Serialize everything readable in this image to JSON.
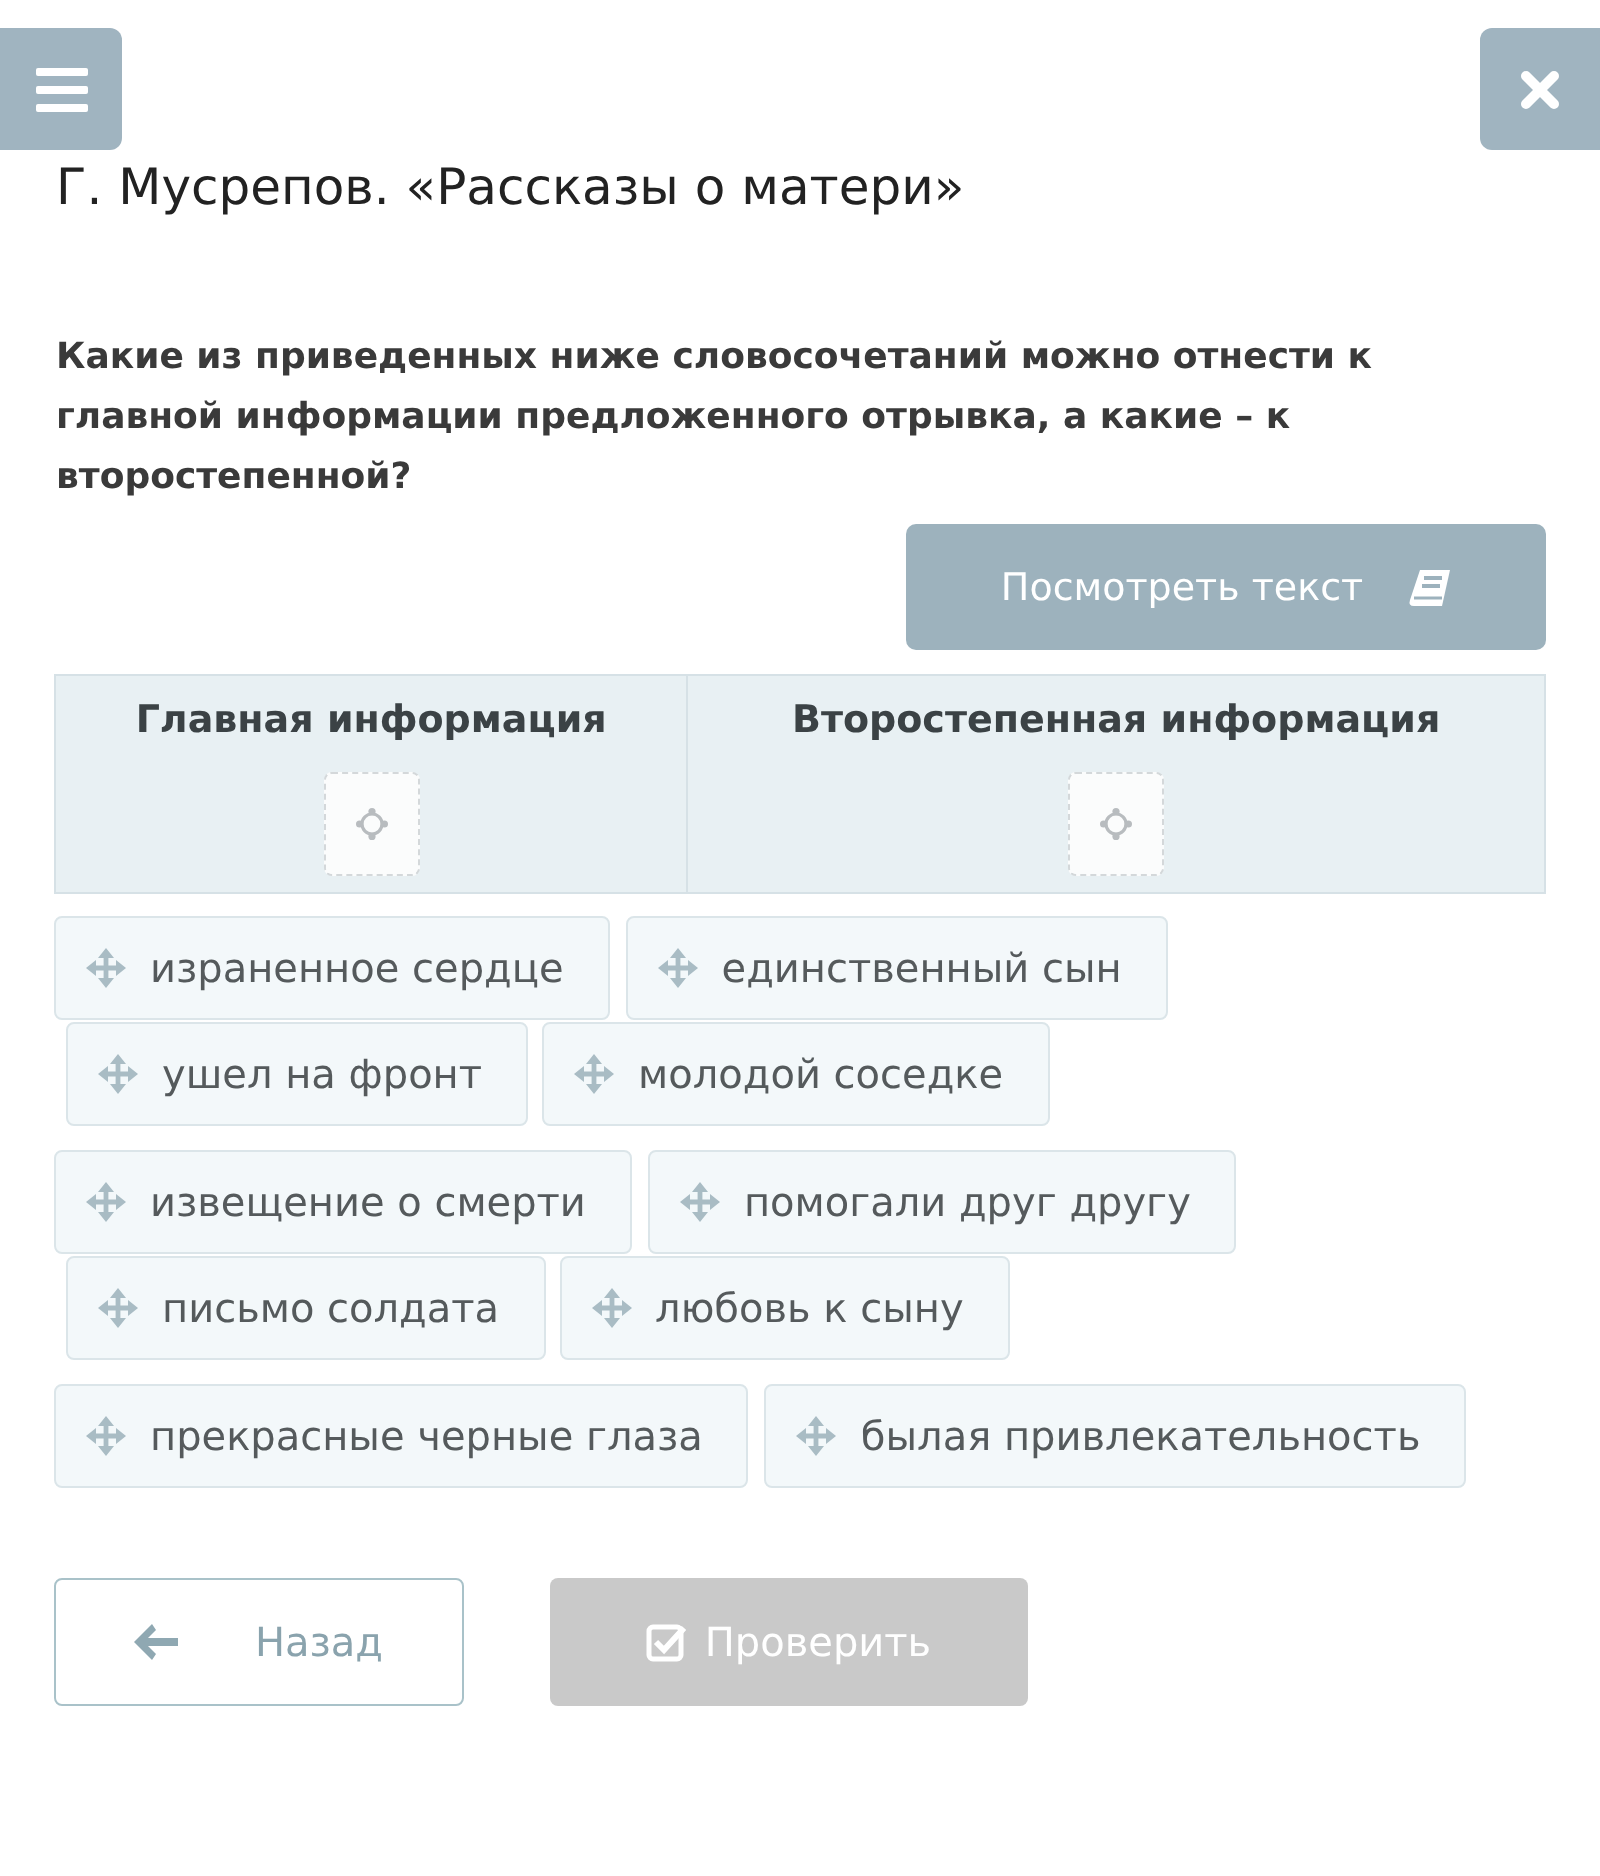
{
  "title": "Г. Мусрепов. «Рассказы о матери»",
  "question": "Какие из приведенных ниже словосочетаний можно отнести к главной информации предложенного отрывка, а какие – к второстепенной?",
  "view_text_button": {
    "label": "Посмотреть текст"
  },
  "columns": [
    {
      "heading": "Главная информация"
    },
    {
      "heading": "Второстепенная информация"
    }
  ],
  "option_groups": [
    {
      "rows": [
        [
          "израненное сердце",
          "единственный сын"
        ],
        [
          "ушел на фронт",
          "молодой соседке"
        ]
      ]
    },
    {
      "rows": [
        [
          "извещение о смерти",
          "помогали друг другу"
        ],
        [
          "письмо солдата",
          "любовь к сыну"
        ]
      ]
    },
    {
      "rows": [
        [
          "прекрасные черные глаза",
          "былая привлекательность"
        ]
      ]
    }
  ],
  "buttons": [
    {
      "kind": "back",
      "label": "Назад",
      "disabled": false
    },
    {
      "kind": "check",
      "label": "Проверить",
      "disabled": true
    }
  ]
}
